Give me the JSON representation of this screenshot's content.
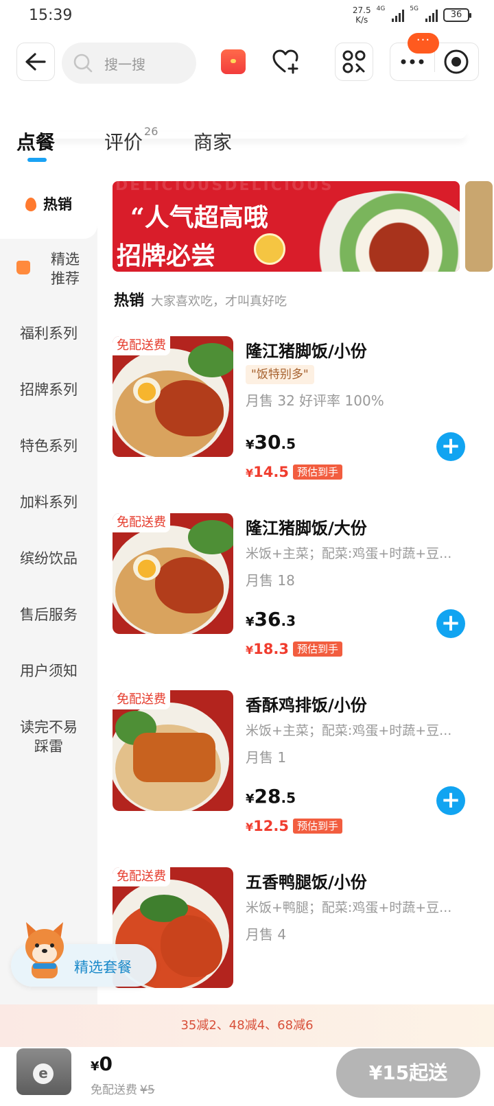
{
  "status_bar": {
    "time": "15:39",
    "net_speed_value": "27.5",
    "net_speed_unit": "K/s",
    "signal_1_label": "4G",
    "signal_2_label": "5G",
    "battery": "36"
  },
  "nav": {
    "search_placeholder": "搜一搜",
    "menu_badge": "···"
  },
  "tabs": {
    "order": "点餐",
    "review": "评价",
    "review_count": "26",
    "merchant": "商家"
  },
  "sidebar": {
    "hot": "热销",
    "featured_line1": "精选",
    "featured_line2": "推荐",
    "items": [
      "福利系列",
      "招牌系列",
      "特色系列",
      "加料系列",
      "缤纷饮品",
      "售后服务",
      "用户须知"
    ],
    "last_line1": "读完不易",
    "last_line2": "踩雷"
  },
  "banner": {
    "bg_text": "DELICIOUSDELICIOUS",
    "title": "“人气超高哦",
    "subtitle": "招牌必尝"
  },
  "section": {
    "title": "热销",
    "subtitle": "大家喜欢吃，才叫真好吃"
  },
  "products": [
    {
      "tag_free": "免配送费",
      "name": "隆江猪脚饭/小份",
      "highlight": "\"饭特别多\"",
      "sales": "月售 32 好评率 100%",
      "price_int": "30",
      "price_dec": ".5",
      "est_price": "14.5",
      "est_label": "预估到手"
    },
    {
      "tag_free": "免配送费",
      "name": "隆江猪脚饭/大份",
      "desc": "米饭+主菜；配菜:鸡蛋+时蔬+豆...",
      "sales": "月售 18",
      "price_int": "36",
      "price_dec": ".3",
      "est_price": "18.3",
      "est_label": "预估到手"
    },
    {
      "tag_free": "免配送费",
      "name": "香酥鸡排饭/小份",
      "desc": "米饭+主菜；配菜:鸡蛋+时蔬+豆...",
      "sales": "月售 1",
      "price_int": "28",
      "price_dec": ".5",
      "est_price": "12.5",
      "est_label": "预估到手"
    },
    {
      "tag_free": "免配送费",
      "name": "五香鸭腿饭/小份",
      "desc": "米饭+鸭腿；配菜:鸡蛋+时蔬+豆...",
      "sales": "月售 4"
    }
  ],
  "currency": "¥",
  "combo_button": "精选套餐",
  "promo_strip": "35减2、48减4、68减6",
  "bottom": {
    "total": "0",
    "delivery_label": "免配送费",
    "delivery_original": "¥5",
    "checkout": "¥15起送"
  },
  "colors": {
    "accent_blue": "#11a4f1",
    "price_red": "#f03c2e",
    "checkout_gray": "#b5b5b5"
  }
}
